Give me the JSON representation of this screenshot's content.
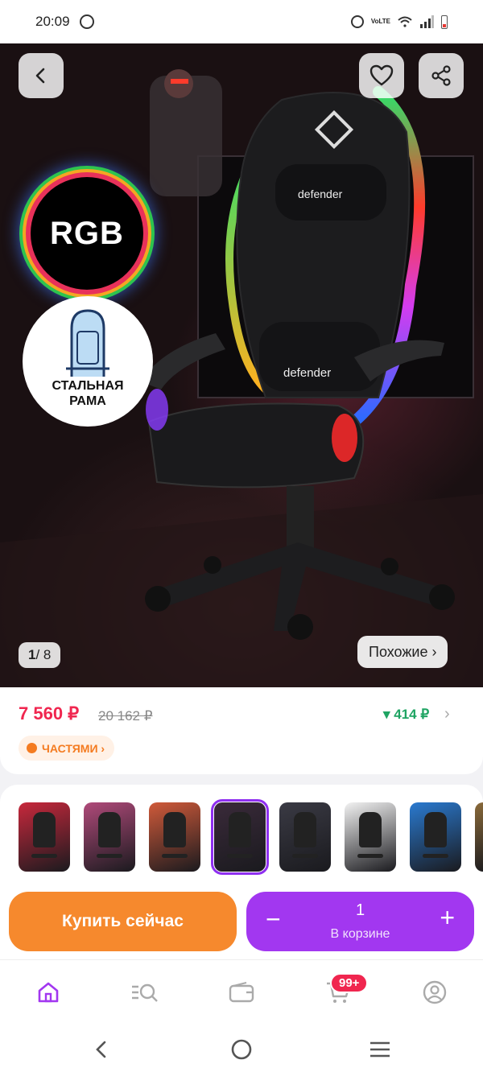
{
  "status_bar": {
    "time": "20:09",
    "icons": [
      "whatsapp-icon",
      "alarm-icon",
      "volte-icon",
      "wifi-icon",
      "signal-icon",
      "battery-icon"
    ],
    "volte_text": "VoLTE"
  },
  "gallery": {
    "badge_rgb": "RGB",
    "badge_steel_line1": "СТАЛЬНАЯ",
    "badge_steel_line2": "РАМА",
    "counter_current": "1",
    "counter_total": "/ 8",
    "similar_label": "Похожие ›",
    "brand_label_1": "defender",
    "brand_label_2": "defender"
  },
  "price": {
    "current": "7 560 ₽",
    "old": "20 162 ₽",
    "drop": "▾ 414 ₽",
    "installments": "ЧАСТЯМИ ›"
  },
  "thumbnails": {
    "count": 8,
    "selected_index": 3,
    "colors": [
      "#c8283c",
      "#b04a7a",
      "#d05a3a",
      "#3a2a3a",
      "#3a3a44",
      "#f2f2f2",
      "#2a7ad0",
      "#8a6a3a"
    ]
  },
  "actions": {
    "buy_now": "Купить сейчас",
    "cart_qty": "1",
    "cart_label": "В корзине",
    "minus": "−",
    "plus": "+"
  },
  "bottom_nav": {
    "cart_badge": "99+",
    "items": [
      "home-icon",
      "catalog-search-icon",
      "wallet-icon",
      "cart-icon",
      "profile-icon"
    ]
  },
  "colors": {
    "accent_purple": "#a237f0",
    "accent_orange": "#f6892d",
    "price_red": "#f0264f",
    "drop_green": "#1fa463"
  }
}
